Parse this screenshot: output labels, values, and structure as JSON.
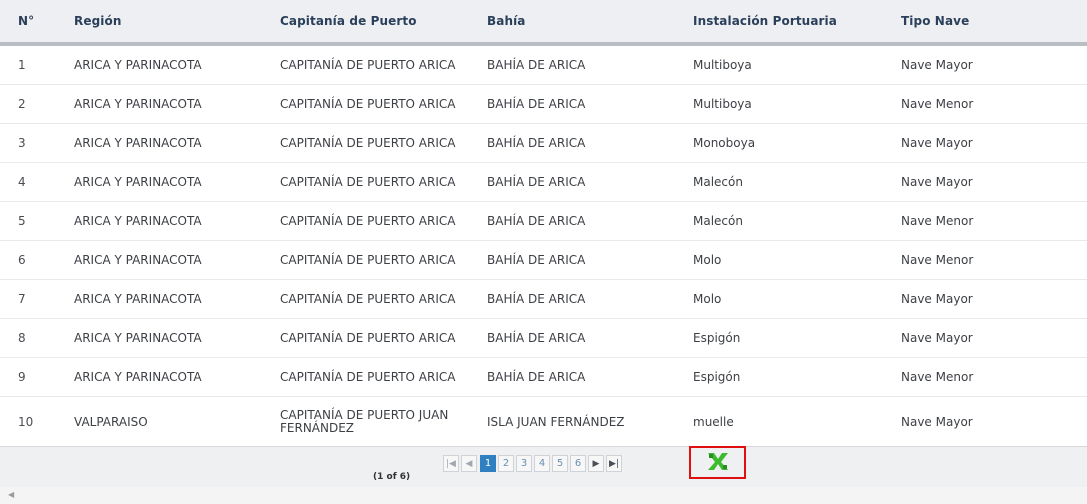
{
  "table": {
    "headers": {
      "num": "N°",
      "region": "Región",
      "capitania": "Capitanía de Puerto",
      "bahia": "Bahía",
      "instalacion": "Instalación Portuaria",
      "tipo": "Tipo Nave"
    },
    "rows": [
      {
        "num": "1",
        "region": "ARICA Y PARINACOTA",
        "capitania": "CAPITANÍA DE PUERTO ARICA",
        "bahia": "BAHÍA DE ARICA",
        "instalacion": "Multiboya",
        "tipo": "Nave Mayor"
      },
      {
        "num": "2",
        "region": "ARICA Y PARINACOTA",
        "capitania": "CAPITANÍA DE PUERTO ARICA",
        "bahia": "BAHÍA DE ARICA",
        "instalacion": "Multiboya",
        "tipo": "Nave Menor"
      },
      {
        "num": "3",
        "region": "ARICA Y PARINACOTA",
        "capitania": "CAPITANÍA DE PUERTO ARICA",
        "bahia": "BAHÍA DE ARICA",
        "instalacion": "Monoboya",
        "tipo": "Nave Mayor"
      },
      {
        "num": "4",
        "region": "ARICA Y PARINACOTA",
        "capitania": "CAPITANÍA DE PUERTO ARICA",
        "bahia": "BAHÍA DE ARICA",
        "instalacion": "Malecón",
        "tipo": "Nave Mayor"
      },
      {
        "num": "5",
        "region": "ARICA Y PARINACOTA",
        "capitania": "CAPITANÍA DE PUERTO ARICA",
        "bahia": "BAHÍA DE ARICA",
        "instalacion": "Malecón",
        "tipo": "Nave Menor"
      },
      {
        "num": "6",
        "region": "ARICA Y PARINACOTA",
        "capitania": "CAPITANÍA DE PUERTO ARICA",
        "bahia": "BAHÍA DE ARICA",
        "instalacion": "Molo",
        "tipo": "Nave Menor"
      },
      {
        "num": "7",
        "region": "ARICA Y PARINACOTA",
        "capitania": "CAPITANÍA DE PUERTO ARICA",
        "bahia": "BAHÍA DE ARICA",
        "instalacion": "Molo",
        "tipo": "Nave Mayor"
      },
      {
        "num": "8",
        "region": "ARICA Y PARINACOTA",
        "capitania": "CAPITANÍA DE PUERTO ARICA",
        "bahia": "BAHÍA DE ARICA",
        "instalacion": "Espigón",
        "tipo": "Nave Mayor"
      },
      {
        "num": "9",
        "region": "ARICA Y PARINACOTA",
        "capitania": "CAPITANÍA DE PUERTO ARICA",
        "bahia": "BAHÍA DE ARICA",
        "instalacion": "Espigón",
        "tipo": "Nave Menor"
      },
      {
        "num": "10",
        "region": "VALPARAISO",
        "capitania": "CAPITANÍA DE PUERTO JUAN FERNÁNDEZ",
        "bahia": "ISLA JUAN FERNÁNDEZ",
        "instalacion": "muelle",
        "tipo": "Nave Mayor"
      }
    ]
  },
  "paginator": {
    "status": "(1 of 6)",
    "first_icon": "first-page-icon",
    "prev_icon": "prev-page-icon",
    "next_icon": "next-page-icon",
    "last_icon": "last-page-icon",
    "pages": [
      "1",
      "2",
      "3",
      "4",
      "5",
      "6"
    ],
    "current_page": "1",
    "active_color": "#2f7fc1"
  },
  "export": {
    "icon": "excel-export-icon",
    "icon_color": "#3dbb2e",
    "highlight_color": "#e01010"
  },
  "scrollbar": {
    "left_arrow_icon": "scroll-left-icon"
  }
}
